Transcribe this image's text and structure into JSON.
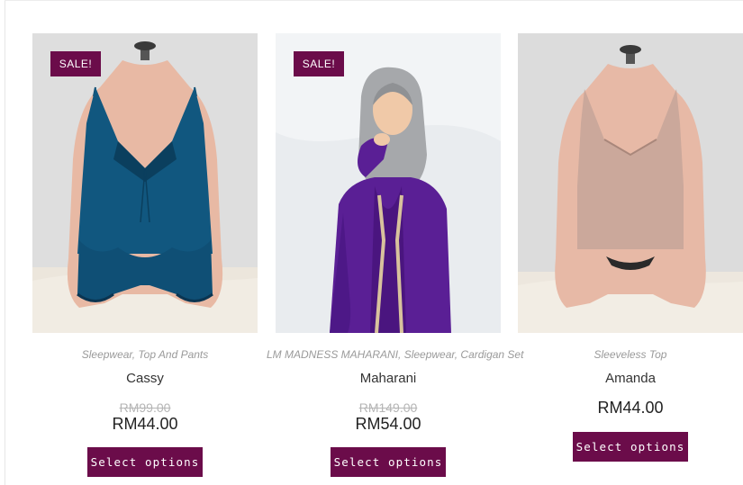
{
  "products": [
    {
      "badge": "SALE!",
      "categories": "Sleepwear, Top And Pants",
      "title": "Cassy",
      "old_price": "RM99.00",
      "price": "RM44.00",
      "button_label": "Select options"
    },
    {
      "badge": "SALE!",
      "categories": "LM MADNESS MAHARANI, Sleepwear, Cardigan Set",
      "title": "Maharani",
      "old_price": "RM149.00",
      "price": "RM54.00",
      "button_label": "Select options"
    },
    {
      "categories": "Sleeveless Top",
      "title": "Amanda",
      "price": "RM44.00",
      "button_label": "Select options"
    }
  ],
  "colors": {
    "accent": "#6b0c4a",
    "category_text": "#9a9a9a",
    "title_text": "#333333",
    "old_price_text": "#b5b5b5"
  }
}
